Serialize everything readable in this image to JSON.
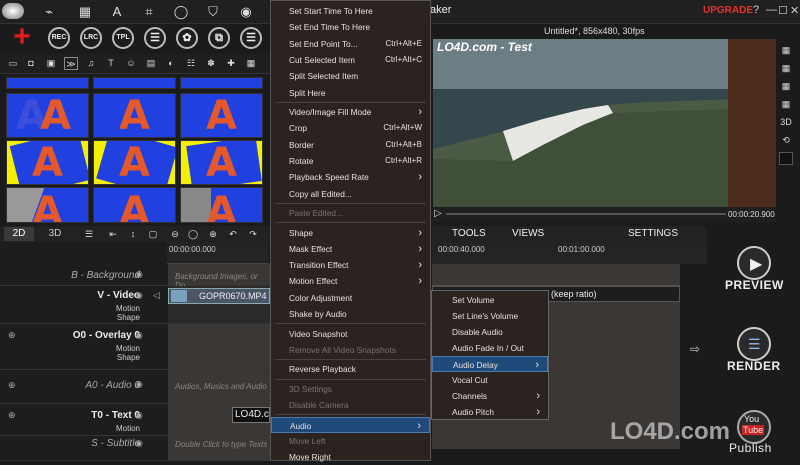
{
  "window": {
    "title_partial": "aker",
    "upgrade_label": "UPGRADE",
    "controls": [
      "?",
      "—",
      "☐",
      "✕"
    ]
  },
  "toolbar_top": {
    "icons": [
      "magnet-icon",
      "timeline-icon",
      "text-icon",
      "crop-icon",
      "pan-icon",
      "shirt-icon"
    ],
    "circle_buttons": [
      "REC",
      "LRC",
      "TPL",
      "☰",
      "✿",
      "⧉",
      "☰"
    ]
  },
  "tabs": {
    "tab_2d": "2D",
    "tab_3d": "3D"
  },
  "timeline": {
    "time_ruler": "00:00:00.000",
    "tracks": [
      {
        "label": "B - Background",
        "hint": "Background Images, or Do"
      },
      {
        "label": "V - Video",
        "sub1": "Motion",
        "sub2": "Shape",
        "clip": "GOPR0670.MP4"
      },
      {
        "label": "O0 - Overlay 0",
        "sub1": "Motion",
        "sub2": "Shape"
      },
      {
        "label": "A0 - Audio 0",
        "hint": "Audios, Musics and Audio"
      },
      {
        "label": "T0 - Text 0",
        "sub1": "Motion",
        "clip": "LO4D.c"
      },
      {
        "label": "S - Subtitle",
        "hint": "Double Click to type Texts"
      }
    ]
  },
  "context_menu": {
    "items": [
      {
        "label": "Set Start Time To Here",
        "shortcut": "",
        "disabled": false,
        "submenu": false
      },
      {
        "label": "Set End Time To Here",
        "shortcut": "",
        "disabled": false,
        "submenu": false
      },
      {
        "label": "Set End Point To...",
        "shortcut": "Ctrl+Alt+E",
        "disabled": false,
        "submenu": false
      },
      {
        "label": "Cut Selected Item",
        "shortcut": "Ctrl+Alt+C",
        "disabled": false,
        "submenu": false
      },
      {
        "label": "Split Selected Item",
        "shortcut": "",
        "disabled": false,
        "submenu": false
      },
      {
        "label": "Split Here",
        "shortcut": "",
        "disabled": false,
        "submenu": false
      },
      {
        "label": "Video/Image Fill Mode",
        "shortcut": "",
        "disabled": false,
        "submenu": true
      },
      {
        "label": "Crop",
        "shortcut": "Ctrl+Alt+W",
        "disabled": false,
        "submenu": false
      },
      {
        "label": "Border",
        "shortcut": "Ctrl+Alt+B",
        "disabled": false,
        "submenu": false
      },
      {
        "label": "Rotate",
        "shortcut": "Ctrl+Alt+R",
        "disabled": false,
        "submenu": false
      },
      {
        "label": "Playback Speed Rate",
        "shortcut": "",
        "disabled": false,
        "submenu": true
      },
      {
        "label": "Copy all Edited...",
        "shortcut": "",
        "disabled": false,
        "submenu": false
      },
      {
        "label": "Paste Edited...",
        "shortcut": "",
        "disabled": true,
        "submenu": false
      },
      {
        "label": "Shape",
        "shortcut": "",
        "disabled": false,
        "submenu": true
      },
      {
        "label": "Mask Effect",
        "shortcut": "",
        "disabled": false,
        "submenu": true
      },
      {
        "label": "Transition Effect",
        "shortcut": "",
        "disabled": false,
        "submenu": true
      },
      {
        "label": "Motion Effect",
        "shortcut": "",
        "disabled": false,
        "submenu": true
      },
      {
        "label": "Color Adjustment",
        "shortcut": "",
        "disabled": false,
        "submenu": false
      },
      {
        "label": "Shake by Audio",
        "shortcut": "",
        "disabled": false,
        "submenu": false
      },
      {
        "label": "Video Snapshot",
        "shortcut": "",
        "disabled": false,
        "submenu": false
      },
      {
        "label": "Remove All Video Snapshots",
        "shortcut": "",
        "disabled": true,
        "submenu": false
      },
      {
        "label": "Reverse Playback",
        "shortcut": "",
        "disabled": false,
        "submenu": false
      },
      {
        "label": "3D Settings",
        "shortcut": "",
        "disabled": true,
        "submenu": false
      },
      {
        "label": "Disable Camera",
        "shortcut": "",
        "disabled": true,
        "submenu": false
      },
      {
        "label": "Audio",
        "shortcut": "",
        "disabled": false,
        "submenu": true,
        "selected": true
      },
      {
        "label": "Move Left",
        "shortcut": "",
        "disabled": true,
        "submenu": false
      },
      {
        "label": "Move Right",
        "shortcut": "",
        "disabled": false,
        "submenu": false
      }
    ]
  },
  "audio_submenu": {
    "items": [
      {
        "label": "Set Volume",
        "submenu": false
      },
      {
        "label": "Set Line's Volume",
        "submenu": false
      },
      {
        "label": "Disable Audio",
        "submenu": false
      },
      {
        "label": "Audio Fade In / Out",
        "submenu": false
      },
      {
        "label": "Audio Delay",
        "submenu": true,
        "selected": true
      },
      {
        "label": "Vocal Cut",
        "submenu": false
      },
      {
        "label": "Channels",
        "submenu": true
      },
      {
        "label": "Audio Pitch",
        "submenu": true
      }
    ]
  },
  "preview": {
    "project_info": "Untitled*, 856x480, 30fps",
    "watermark": "LO4D.com - Test",
    "time": "00:00:20.900",
    "tabs": [
      "TOOLS",
      "VIEWS",
      "SETTINGS"
    ],
    "ruler_times": [
      "00:00:40.000",
      "00:01:00.000"
    ],
    "clip_text": "(keep ratio)",
    "right_tools": [
      "grid-icon",
      "grid-icon",
      "grid-icon",
      "grid-icon",
      "3D",
      "refresh-icon",
      "square-icon"
    ]
  },
  "actions": {
    "preview_label": "PREVIEW",
    "render_label": "RENDER",
    "youtube_label1": "You",
    "youtube_label2": "Tube",
    "publish_label": "Publish"
  },
  "site_watermark": "LO4D.com",
  "colors": {
    "accent_red": "#e8332a",
    "menu_bg": "#2a2320",
    "highlight": "#1f4a7a",
    "thumb_blue": "#2140e0",
    "thumb_yellow": "#f5f000",
    "letter": "#e3592b"
  }
}
